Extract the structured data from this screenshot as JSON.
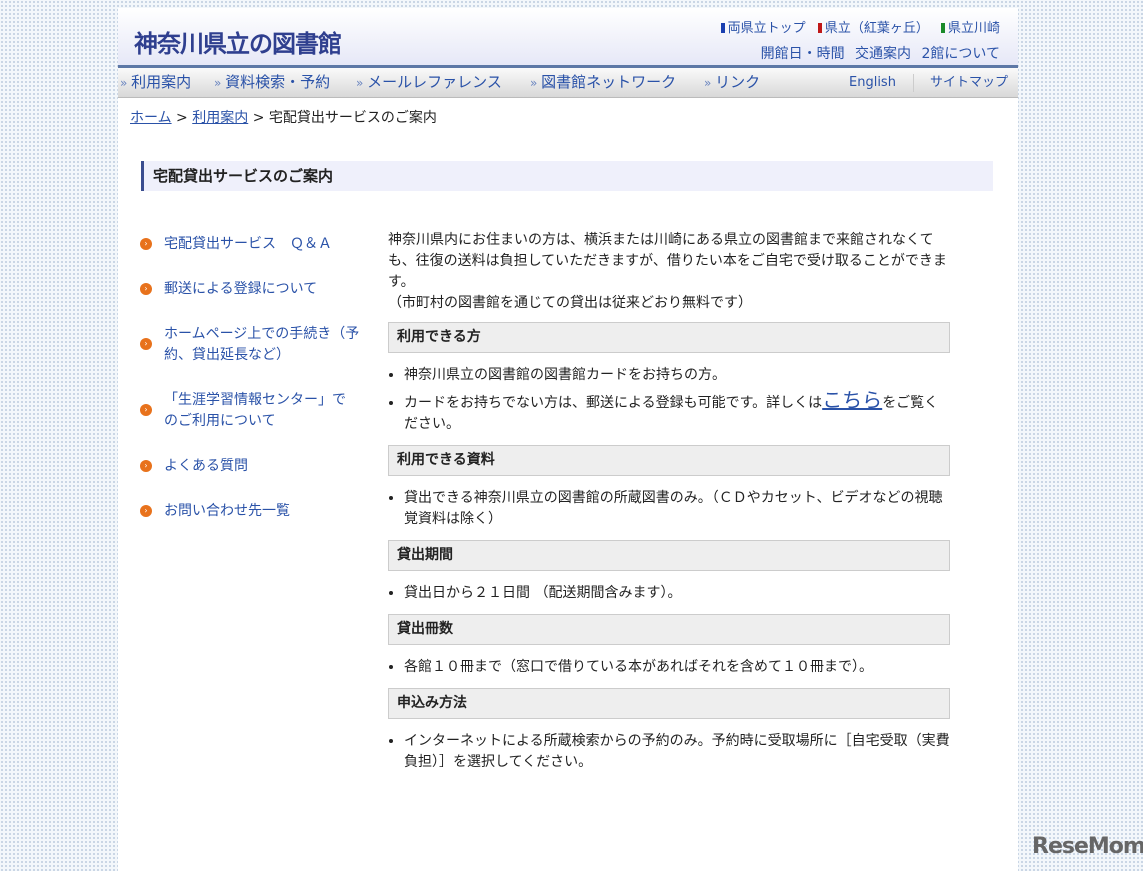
{
  "header": {
    "logo": "神奈川県立の図書館",
    "top_links": [
      {
        "label": "両県立トップ",
        "color": "#1a3fb0"
      },
      {
        "label": "県立（紅葉ヶ丘）",
        "color": "#c01818"
      },
      {
        "label": "県立川崎",
        "color": "#1a8a2a"
      }
    ],
    "sub_links": [
      "開館日・時間",
      "交通案内",
      "2館について"
    ]
  },
  "nav": {
    "items": [
      "利用案内",
      "資料検索・予約",
      "メールレファレンス",
      "図書館ネットワーク",
      "リンク"
    ],
    "english": "English",
    "sitemap": "サイトマップ"
  },
  "breadcrumb": {
    "home": "ホーム",
    "parent": "利用案内",
    "sep": ">",
    "current": "宅配貸出サービスのご案内"
  },
  "page_title": "宅配貸出サービスのご案内",
  "sidebar": [
    "宅配貸出サービス　Ｑ＆Ａ",
    "郵送による登録について",
    "ホームページ上での手続き（予約、貸出延長など）",
    "「生涯学習情報センター」でのご利用について",
    "よくある質問",
    "お問い合わせ先一覧"
  ],
  "main": {
    "intro": "神奈川県内にお住まいの方は、横浜または川崎にある県立の図書館まで来館されなくても、往復の送料は負担していただきますが、借りたい本をご自宅で受け取ることができます。",
    "intro_note": "（市町村の図書館を通じての貸出は従来どおり無料です）",
    "sections": [
      {
        "heading": "利用できる方",
        "items": [
          "神奈川県立の図書館の図書館カードをお持ちの方。"
        ],
        "card_text": "カードをお持ちでない方は、郵送による登録も可能です。詳しくは",
        "card_link": "こちら",
        "card_after": "をご覧ください。"
      },
      {
        "heading": "利用できる資料",
        "items": [
          "貸出できる神奈川県立の図書館の所蔵図書のみ。（ＣＤやカセット、ビデオなどの視聴覚資料は除く）"
        ]
      },
      {
        "heading": "貸出期間",
        "items": [
          "貸出日から２１日間 （配送期間含みます）。"
        ]
      },
      {
        "heading": "貸出冊数",
        "items": [
          "各館１０冊まで（窓口で借りている本があればそれを含めて１０冊まで）。"
        ]
      },
      {
        "heading": "申込み方法",
        "items": [
          "インターネットによる所蔵検索からの予約のみ。予約時に受取場所に［自宅受取（実費負担）］を選択してください。"
        ]
      }
    ]
  },
  "watermark": "ReseMom"
}
